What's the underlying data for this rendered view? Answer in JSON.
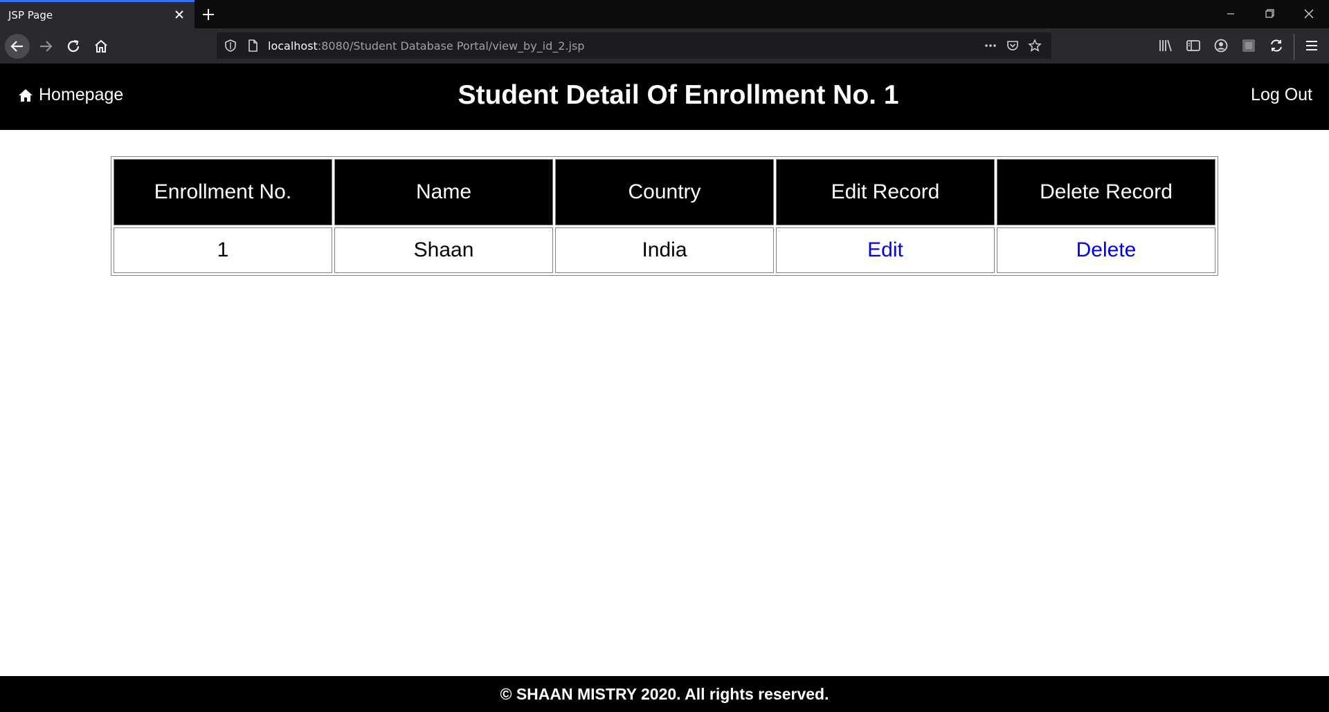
{
  "browser": {
    "tab_title": "JSP Page",
    "url_host": "localhost",
    "url_rest": ":8080/Student Database Portal/view_by_id_2.jsp"
  },
  "header": {
    "home_label": "Homepage",
    "title": "Student Detail Of Enrollment No. 1",
    "logout_label": "Log Out"
  },
  "table": {
    "columns": [
      "Enrollment No.",
      "Name",
      "Country",
      "Edit Record",
      "Delete Record"
    ],
    "rows": [
      {
        "enrollment_no": "1",
        "name": "Shaan",
        "country": "India",
        "edit_label": "Edit",
        "delete_label": "Delete"
      }
    ]
  },
  "footer": {
    "text": "© SHAAN MISTRY 2020. All rights reserved."
  },
  "colors": {
    "header_bg": "#000000",
    "link": "#0000ee",
    "tab_accent": "#3870f6"
  }
}
